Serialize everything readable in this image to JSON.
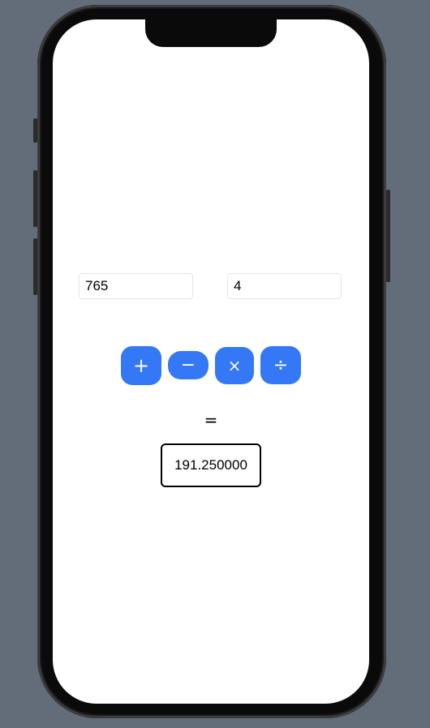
{
  "inputs": {
    "first_value": "765",
    "second_value": "4"
  },
  "operators": {
    "add": "+",
    "subtract": "−",
    "multiply": "×",
    "divide": "÷"
  },
  "equals_sign": "=",
  "result": "191.250000",
  "colors": {
    "accent": "#3478f6",
    "background": "#636d79",
    "screen": "#ffffff"
  }
}
